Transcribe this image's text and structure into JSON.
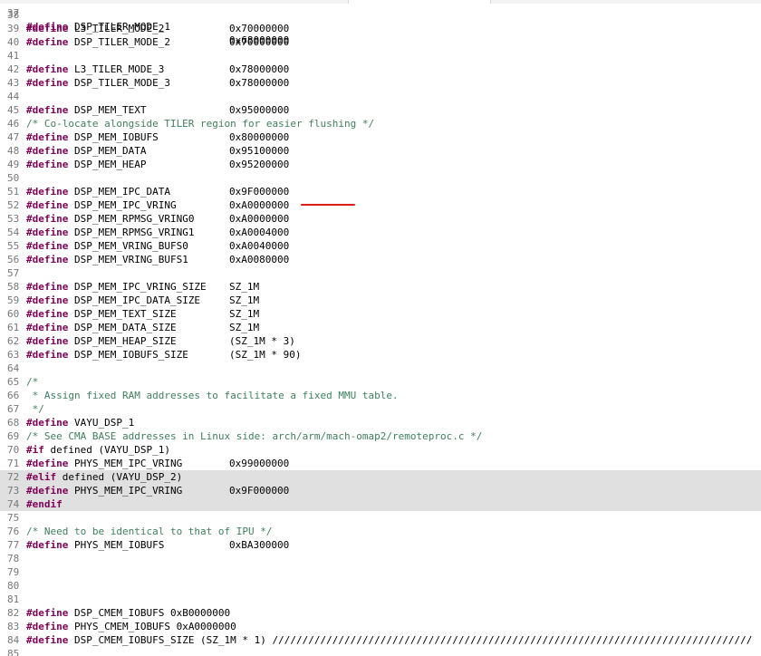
{
  "editor": {
    "top_partial": {
      "num": "37",
      "kw": "#define",
      "name": "DSP_TILER_MODE_1",
      "value": "0x68000000"
    },
    "lines": [
      {
        "num": "38"
      },
      {
        "num": "39",
        "kw": "#define",
        "name": "L3_TILER_MODE_2",
        "value": "0x70000000"
      },
      {
        "num": "40",
        "kw": "#define",
        "name": "DSP_TILER_MODE_2",
        "value": "0x70000000"
      },
      {
        "num": "41"
      },
      {
        "num": "42",
        "kw": "#define",
        "name": "L3_TILER_MODE_3",
        "value": "0x78000000"
      },
      {
        "num": "43",
        "kw": "#define",
        "name": "DSP_TILER_MODE_3",
        "value": "0x78000000"
      },
      {
        "num": "44"
      },
      {
        "num": "45",
        "kw": "#define",
        "name": "DSP_MEM_TEXT",
        "value": "0x95000000"
      },
      {
        "num": "46",
        "comment": "/* Co-locate alongside TILER region for easier flushing */"
      },
      {
        "num": "47",
        "kw": "#define",
        "name": "DSP_MEM_IOBUFS",
        "value": "0x80000000"
      },
      {
        "num": "48",
        "kw": "#define",
        "name": "DSP_MEM_DATA",
        "value": "0x95100000"
      },
      {
        "num": "49",
        "kw": "#define",
        "name": "DSP_MEM_HEAP",
        "value": "0x95200000"
      },
      {
        "num": "50"
      },
      {
        "num": "51",
        "kw": "#define",
        "name": "DSP_MEM_IPC_DATA",
        "value": "0x9F000000"
      },
      {
        "num": "52",
        "kw": "#define",
        "name": "DSP_MEM_IPC_VRING",
        "value": "0xA0000000"
      },
      {
        "num": "53",
        "kw": "#define",
        "name": "DSP_MEM_RPMSG_VRING0",
        "value": "0xA0000000"
      },
      {
        "num": "54",
        "kw": "#define",
        "name": "DSP_MEM_RPMSG_VRING1",
        "value": "0xA0004000"
      },
      {
        "num": "55",
        "kw": "#define",
        "name": "DSP_MEM_VRING_BUFS0",
        "value": "0xA0040000"
      },
      {
        "num": "56",
        "kw": "#define",
        "name": "DSP_MEM_VRING_BUFS1",
        "value": "0xA0080000"
      },
      {
        "num": "57"
      },
      {
        "num": "58",
        "kw": "#define",
        "name": "DSP_MEM_IPC_VRING_SIZE",
        "value": "SZ_1M"
      },
      {
        "num": "59",
        "kw": "#define",
        "name": "DSP_MEM_IPC_DATA_SIZE",
        "value": "SZ_1M"
      },
      {
        "num": "60",
        "kw": "#define",
        "name": "DSP_MEM_TEXT_SIZE",
        "value": "SZ_1M"
      },
      {
        "num": "61",
        "kw": "#define",
        "name": "DSP_MEM_DATA_SIZE",
        "value": "SZ_1M"
      },
      {
        "num": "62",
        "kw": "#define",
        "name": "DSP_MEM_HEAP_SIZE",
        "value": "(SZ_1M * 3)"
      },
      {
        "num": "63",
        "kw": "#define",
        "name": "DSP_MEM_IOBUFS_SIZE",
        "value": "(SZ_1M * 90)"
      },
      {
        "num": "64"
      },
      {
        "num": "65",
        "comment": "/*"
      },
      {
        "num": "66",
        "comment": " * Assign fixed RAM addresses to facilitate a fixed MMU table."
      },
      {
        "num": "67",
        "comment": " */"
      },
      {
        "num": "68",
        "kw": "#define",
        "name": "VAYU_DSP_1"
      },
      {
        "num": "69",
        "comment": "/* See CMA BASE addresses in Linux side: arch/arm/mach-omap2/remoteproc.c */"
      },
      {
        "num": "70",
        "kw": "#if",
        "name": "defined (VAYU_DSP_1)"
      },
      {
        "num": "71",
        "kw": "#define",
        "name": "PHYS_MEM_IPC_VRING",
        "value": "0x99000000"
      },
      {
        "num": "72",
        "kw": "#elif",
        "name": "defined (VAYU_DSP_2)",
        "hl": true
      },
      {
        "num": "73",
        "kw": "#define",
        "name": "PHYS_MEM_IPC_VRING",
        "value": "0x9F000000",
        "hl": true
      },
      {
        "num": "74",
        "kw": "#endif",
        "hl": true
      },
      {
        "num": "75"
      },
      {
        "num": "76",
        "comment": "/* Need to be identical to that of IPU */"
      },
      {
        "num": "77",
        "kw": "#define",
        "name": "PHYS_MEM_IOBUFS",
        "value": "0xBA300000"
      },
      {
        "num": "78"
      },
      {
        "num": "79"
      },
      {
        "num": "80"
      },
      {
        "num": "81"
      },
      {
        "num": "82",
        "kw": "#define",
        "name": "DSP_CMEM_IOBUFS 0xB0000000"
      },
      {
        "num": "83",
        "kw": "#define",
        "name": "PHYS_CMEM_IOBUFS 0xA0000000"
      },
      {
        "num": "84",
        "kw": "#define",
        "name": "DSP_CMEM_IOBUFS_SIZE (SZ_1M * 1) ////////////////////////////////////////////////////////////////////////////////"
      },
      {
        "num": "85"
      }
    ]
  }
}
